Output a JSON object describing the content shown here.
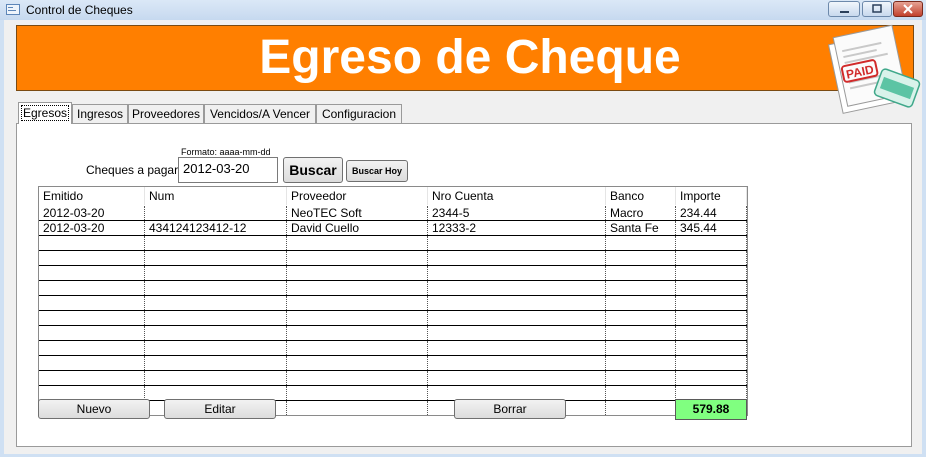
{
  "window": {
    "title": "Control de Cheques",
    "buttons": [
      "minimize",
      "maximize",
      "close"
    ]
  },
  "banner": {
    "title": "Egreso de Cheque",
    "bg_color": "#ff7f00",
    "logo_text": "PAID"
  },
  "tabs": [
    {
      "label": "Egresos",
      "active": true
    },
    {
      "label": "Ingresos",
      "active": false
    },
    {
      "label": "Proveedores",
      "active": false
    },
    {
      "label": "Vencidos/A Vencer",
      "active": false
    },
    {
      "label": "Configuracion",
      "active": false
    }
  ],
  "search": {
    "format_hint": "Formato: aaaa-mm-dd",
    "label": "Cheques a pagar:",
    "date_value": "2012-03-20",
    "buscar_label": "Buscar",
    "buscar_hoy_label": "Buscar Hoy"
  },
  "table": {
    "columns": [
      "Emitido",
      "Num",
      "Proveedor",
      "Nro Cuenta",
      "Banco",
      "Importe"
    ],
    "rows": [
      [
        "2012-03-20",
        "",
        "NeoTEC Soft",
        "2344-5",
        "Macro",
        "234.44"
      ],
      [
        "2012-03-20",
        "434124123412-12",
        "David Cuello",
        "12333-2",
        "Santa Fe",
        "345.44"
      ],
      [
        "",
        "",
        "",
        "",
        "",
        ""
      ],
      [
        "",
        "",
        "",
        "",
        "",
        ""
      ],
      [
        "",
        "",
        "",
        "",
        "",
        ""
      ],
      [
        "",
        "",
        "",
        "",
        "",
        ""
      ],
      [
        "",
        "",
        "",
        "",
        "",
        ""
      ],
      [
        "",
        "",
        "",
        "",
        "",
        ""
      ],
      [
        "",
        "",
        "",
        "",
        "",
        ""
      ],
      [
        "",
        "",
        "",
        "",
        "",
        ""
      ],
      [
        "",
        "",
        "",
        "",
        "",
        ""
      ],
      [
        "",
        "",
        "",
        "",
        "",
        ""
      ],
      [
        "",
        "",
        "",
        "",
        "",
        ""
      ],
      [
        "",
        "",
        "",
        "",
        "",
        ""
      ]
    ]
  },
  "actions": {
    "nuevo_label": "Nuevo",
    "editar_label": "Editar",
    "borrar_label": "Borrar"
  },
  "total": {
    "value": "579.88",
    "bg_color": "#80ff80"
  }
}
